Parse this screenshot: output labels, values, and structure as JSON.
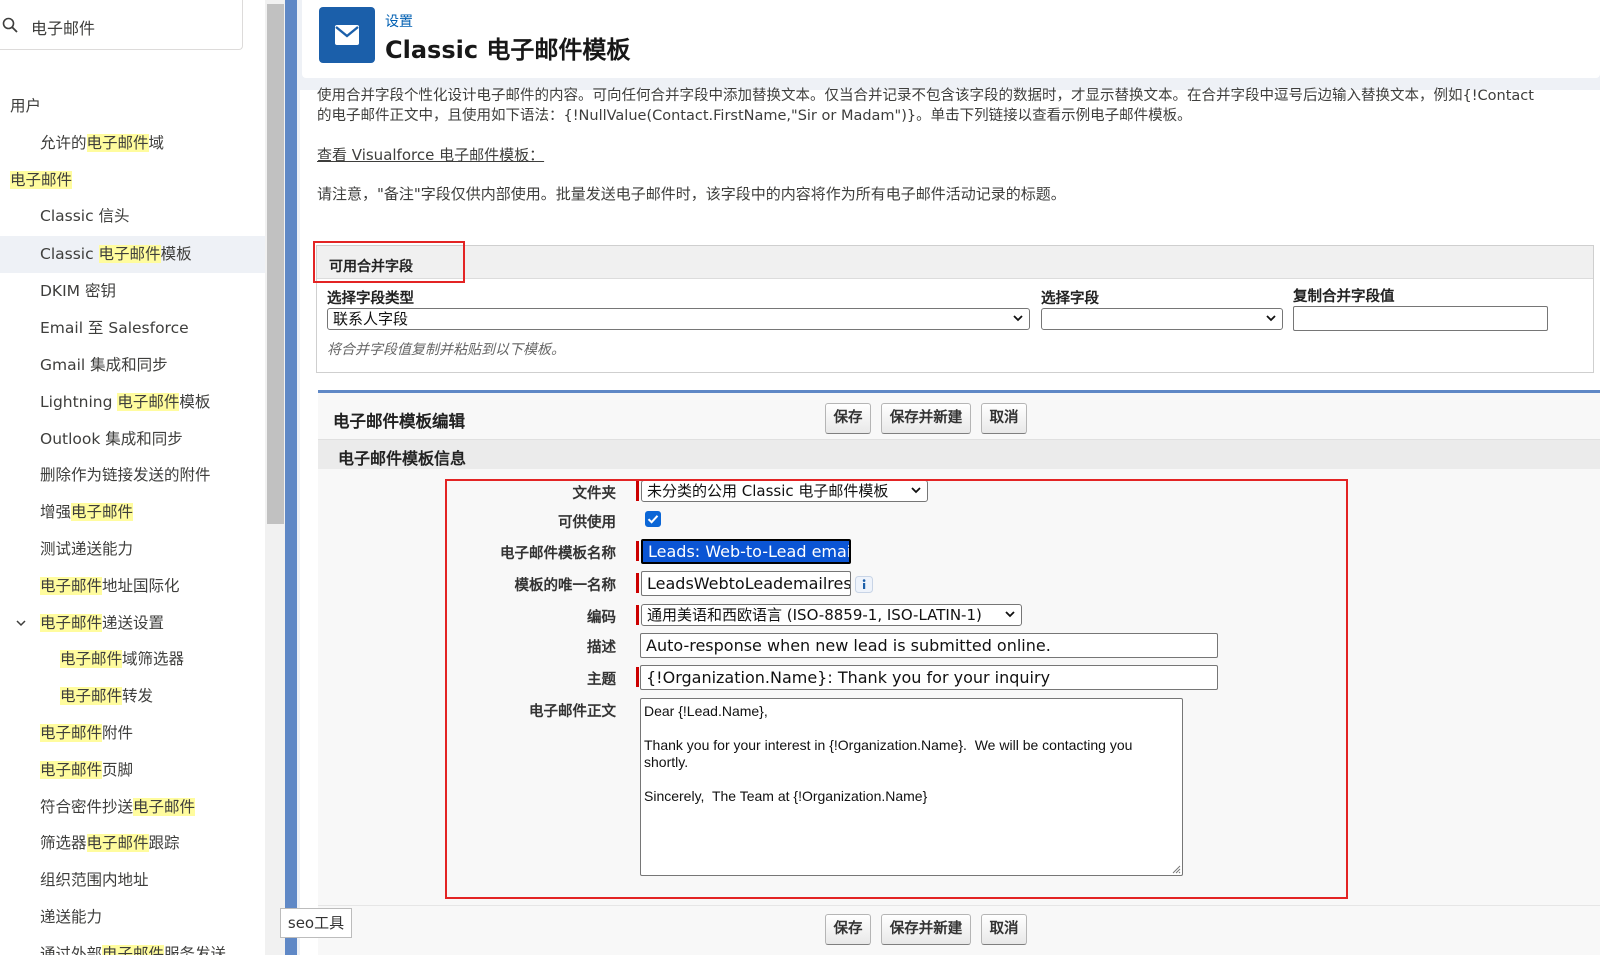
{
  "sidebar": {
    "quick_find": "电子邮件",
    "items": [
      {
        "level": 0,
        "pre": "用户",
        "hl": "",
        "post": ""
      },
      {
        "level": 1,
        "pre": "允许的",
        "hl": "电子邮件",
        "post": "域"
      },
      {
        "level": 0,
        "pre": "",
        "hl": "电子邮件",
        "post": ""
      },
      {
        "level": 1,
        "pre": "Classic 信头",
        "hl": "",
        "post": ""
      },
      {
        "level": 1,
        "pre": "Classic ",
        "hl": "电子邮件",
        "post": "模板",
        "active": true
      },
      {
        "level": 1,
        "pre": "DKIM 密钥",
        "hl": "",
        "post": ""
      },
      {
        "level": 1,
        "pre": "Email 至 Salesforce",
        "hl": "",
        "post": ""
      },
      {
        "level": 1,
        "pre": "Gmail 集成和同步",
        "hl": "",
        "post": ""
      },
      {
        "level": 1,
        "pre": "Lightning ",
        "hl": "电子邮件",
        "post": "模板"
      },
      {
        "level": 1,
        "pre": "Outlook 集成和同步",
        "hl": "",
        "post": ""
      },
      {
        "level": 1,
        "pre": "删除作为链接发送的附件",
        "hl": "",
        "post": ""
      },
      {
        "level": 1,
        "pre": "增强",
        "hl": "电子邮件",
        "post": ""
      },
      {
        "level": 1,
        "pre": "测试递送能力",
        "hl": "",
        "post": ""
      },
      {
        "level": 1,
        "pre": "",
        "hl": "电子邮件",
        "post": "地址国际化"
      },
      {
        "level": 1,
        "pre": "",
        "hl": "电子邮件",
        "post": "递送设置",
        "expanded": true
      },
      {
        "level": 2,
        "pre": "",
        "hl": "电子邮件",
        "post": "域筛选器"
      },
      {
        "level": 2,
        "pre": "",
        "hl": "电子邮件",
        "post": "转发"
      },
      {
        "level": 1,
        "pre": "",
        "hl": "电子邮件",
        "post": "附件"
      },
      {
        "level": 1,
        "pre": "",
        "hl": "电子邮件",
        "post": "页脚"
      },
      {
        "level": 1,
        "pre": "符合密件抄送",
        "hl": "电子邮件",
        "post": ""
      },
      {
        "level": 1,
        "pre": "筛选器",
        "hl": "电子邮件",
        "post": "跟踪"
      },
      {
        "level": 1,
        "pre": "组织范围内地址",
        "hl": "",
        "post": ""
      },
      {
        "level": 1,
        "pre": "递送能力",
        "hl": "",
        "post": ""
      },
      {
        "level": 1,
        "pre": "通过外部",
        "hl": "电子邮件",
        "post": "服务发送"
      }
    ]
  },
  "header": {
    "breadcrumb": "设置",
    "title": "Classic 电子邮件模板"
  },
  "intro": {
    "line1": "使用合并字段个性化设计电子邮件的内容。可向任何合并字段中添加替换文本。仅当合并记录不包含该字段的数据时，才显示替换文本。在合并字段中逗号后边输入替换文本，例如{!Contact",
    "line2": "的电子邮件正文中，且使用如下语法：{!NullValue(Contact.FirstName,\"Sir or Madam\")}。单击下列链接以查看示例电子邮件模板。",
    "vf_link": "查看 Visualforce 电子邮件模板：",
    "note": "请注意，\"备注\"字段仅供内部使用。批量发送电子邮件时，该字段中的内容将作为所有电子邮件活动记录的标题。"
  },
  "merge": {
    "title": "可用合并字段",
    "type_label": "选择字段类型",
    "type_value": "联系人字段",
    "field_label": "选择字段",
    "field_value": "",
    "copy_label": "复制合并字段值",
    "copy_value": "",
    "hint": "将合并字段值复制并粘贴到以下模板。"
  },
  "edit": {
    "title": "电子邮件模板编辑",
    "save": "保存",
    "save_new": "保存并新建",
    "cancel": "取消",
    "section": "电子邮件模板信息",
    "folder_label": "文件夹",
    "folder_value": "未分类的公用 Classic 电子邮件模板",
    "available_label": "可供使用",
    "available_checked": true,
    "name_label": "电子邮件模板名称",
    "name_value": "Leads:  Web-to-Lead email",
    "unique_label": "模板的唯一名称",
    "unique_value": "LeadsWebtoLeademailresp",
    "encoding_label": "编码",
    "encoding_value": "通用美语和西欧语言 (ISO-8859-1, ISO-LATIN-1)",
    "desc_label": "描述",
    "desc_value": "Auto-response when new lead is submitted online.",
    "subject_label": "主题",
    "subject_value": "{!Organization.Name}:  Thank you for your inquiry",
    "body_label": "电子邮件正文",
    "body_value": "Dear {!Lead.Name},\n\nThank you for your interest in {!Organization.Name}.  We will be contacting you shortly.\n\nSincerely,  The Team at {!Organization.Name}"
  },
  "seo_tag": "seo工具",
  "colors": {
    "accent": "#1b5faa",
    "highlight": "#fffc9e",
    "annotation_red": "#e32424",
    "required": "#cc0000"
  }
}
